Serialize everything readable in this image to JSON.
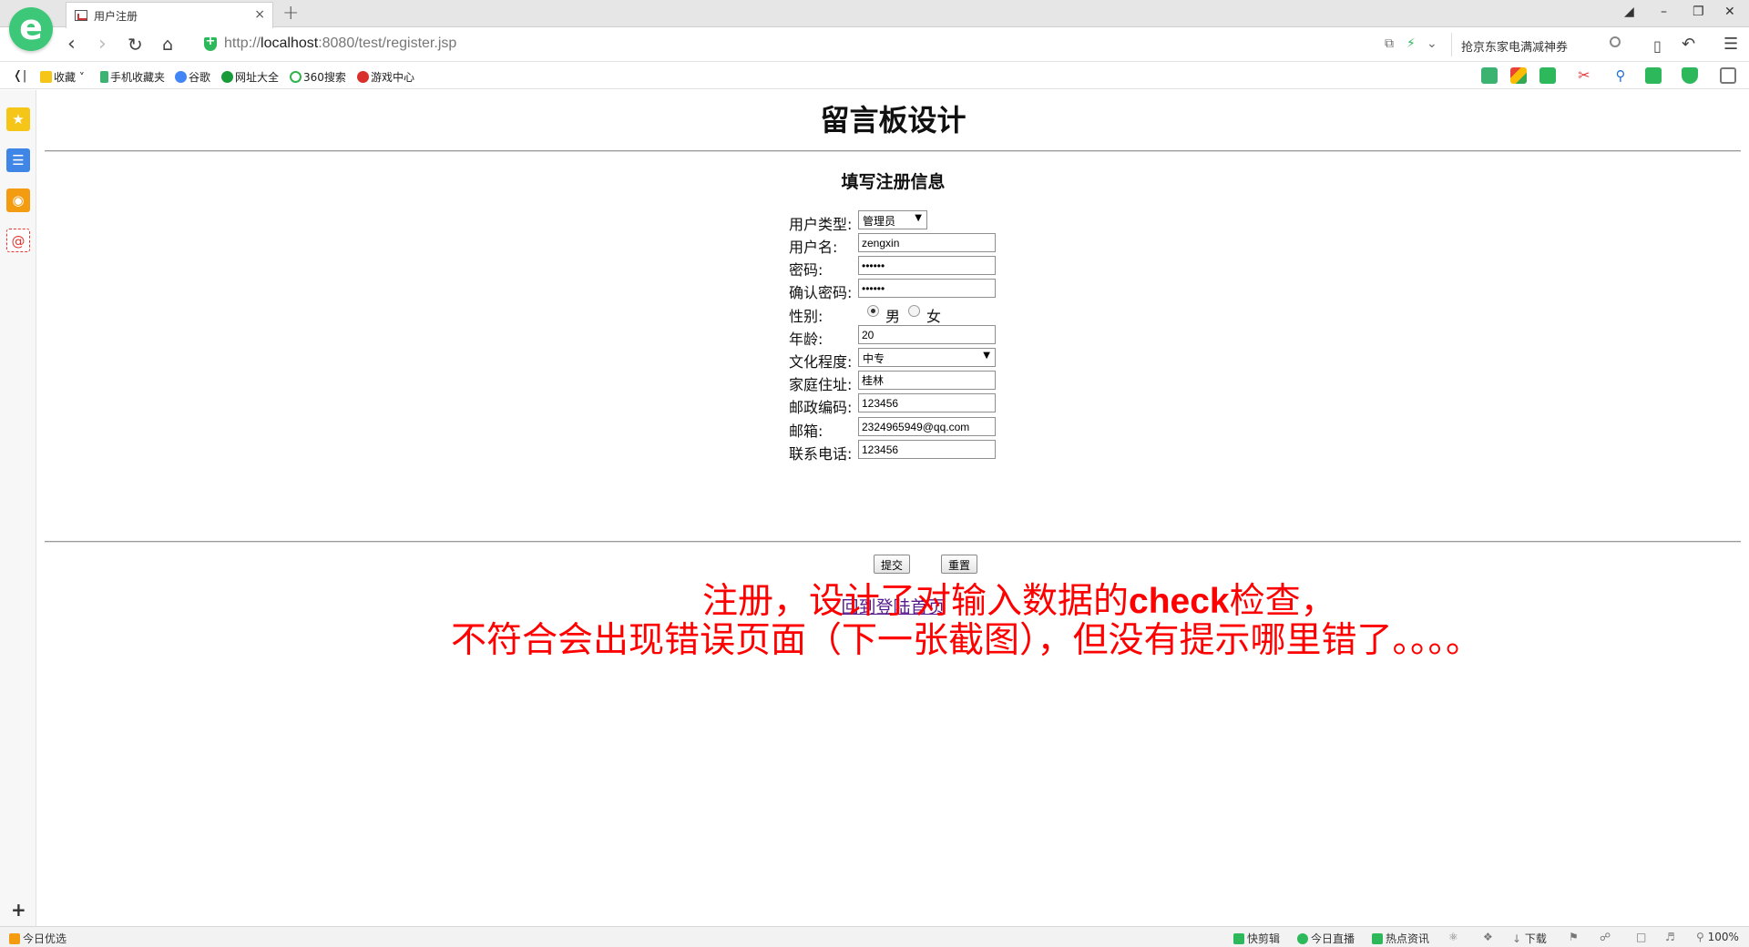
{
  "browser": {
    "tab_title": "用户注册",
    "tab_close": "×",
    "new_tab": "+",
    "url_prefix": "http://",
    "url_host": "localhost",
    "url_rest": ":8080/test/register.jsp",
    "search_placeholder": "抢京东家电满减神券",
    "zoom": "100%"
  },
  "bookmarks": [
    {
      "label": "收藏",
      "color": "#f5c518"
    },
    {
      "label": "手机收藏夹",
      "color": "#3cb371"
    },
    {
      "label": "谷歌",
      "color": "#4285f4"
    },
    {
      "label": "网址大全",
      "color": "#1a9b3a"
    },
    {
      "label": "360搜索",
      "color": "#2fb34a"
    },
    {
      "label": "游戏中心",
      "color": "#d9302c"
    }
  ],
  "page": {
    "title": "留言板设计",
    "form_heading": "填写注册信息",
    "fields": {
      "user_type_label": "用户类型:",
      "user_type_value": "管理员",
      "username_label": "用户名:",
      "username_value": "zengxin",
      "password_label": "密码:",
      "password_value": "••••••",
      "confirm_label": "确认密码:",
      "confirm_value": "••••••",
      "gender_label": "性别:",
      "gender_male": "男",
      "gender_female": "女",
      "age_label": "年龄:",
      "age_value": "20",
      "education_label": "文化程度:",
      "education_value": "中专",
      "address_label": "家庭住址:",
      "address_value": "桂林",
      "zip_label": "邮政编码:",
      "zip_value": "123456",
      "email_label": "邮箱:",
      "email_value": "2324965949@qq.com",
      "phone_label": "联系电话:",
      "phone_value": "123456"
    },
    "submit_label": "提交",
    "reset_label": "重置",
    "back_link": "回到登陆首页",
    "note_line1_a": "注册，设计了对输入数据的",
    "note_line1_b": "check",
    "note_line1_c": "检查，",
    "note_line2": "不符合会出现错误页面（下一张截图），但没有提示哪里错了。。。。"
  },
  "statusbar": {
    "left": "今日优选",
    "items": [
      "快剪辑",
      "今日直播",
      "热点资讯",
      "下载"
    ]
  },
  "colors": {
    "brand_green": "#3cc878",
    "note_red": "#ff0000",
    "link_visited": "#551a8b"
  }
}
